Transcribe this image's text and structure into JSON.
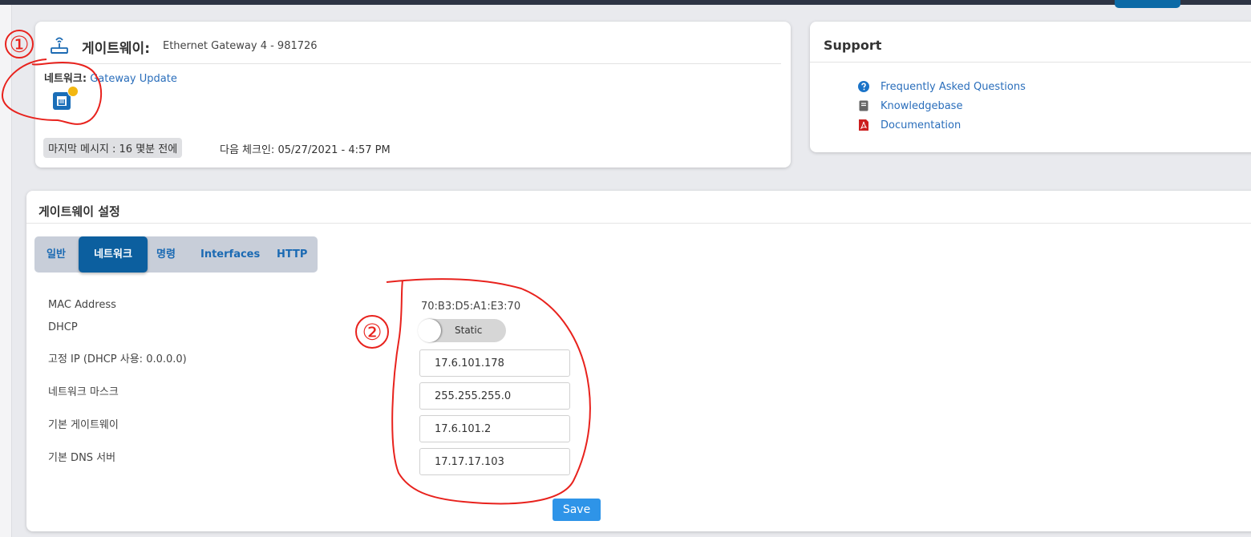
{
  "gateway": {
    "title": "게이트웨이:",
    "name": "Ethernet Gateway 4 - 981726",
    "network_label": "네트워크:",
    "network_link": "Gateway Update",
    "last_message": "마지막 메시지 : 16 몇분 전에",
    "next_checkin": "다음 체크인: 05/27/2021 - 4:57 PM"
  },
  "support": {
    "title": "Support",
    "items": [
      {
        "label": "Frequently Asked Questions",
        "icon": "question-circle-icon",
        "color": "#1a73c8"
      },
      {
        "label": "Knowledgebase",
        "icon": "book-icon",
        "color": "#666666"
      },
      {
        "label": "Documentation",
        "icon": "pdf-file-icon",
        "color": "#cc1f1f"
      }
    ]
  },
  "settings": {
    "title": "게이트웨이 설정",
    "tabs": [
      "일반",
      "네트워크",
      "명령",
      "Interfaces",
      "HTTP"
    ],
    "active_tab": "네트워크",
    "labels": {
      "mac": "MAC Address",
      "dhcp": "DHCP",
      "static_ip": "고정 IP (DHCP 사용: 0.0.0.0)",
      "netmask": "네트워크 마스크",
      "gateway": "기본 게이트웨이",
      "dns": "기본 DNS 서버"
    },
    "values": {
      "mac": "70:B3:D5:A1:E3:70",
      "dhcp_toggle": "Static",
      "static_ip": "17.6.101.178",
      "netmask": "255.255.255.0",
      "gateway": "17.6.101.2",
      "dns": "17.17.17.103"
    },
    "save_label": "Save"
  },
  "annotations": {
    "marker_1": "①",
    "marker_2": "②",
    "color": "#e8221d"
  },
  "colors": {
    "accent": "#0c5f9f",
    "link": "#2a6ebb",
    "save": "#2e94e8",
    "status_dot": "#f2b712"
  }
}
